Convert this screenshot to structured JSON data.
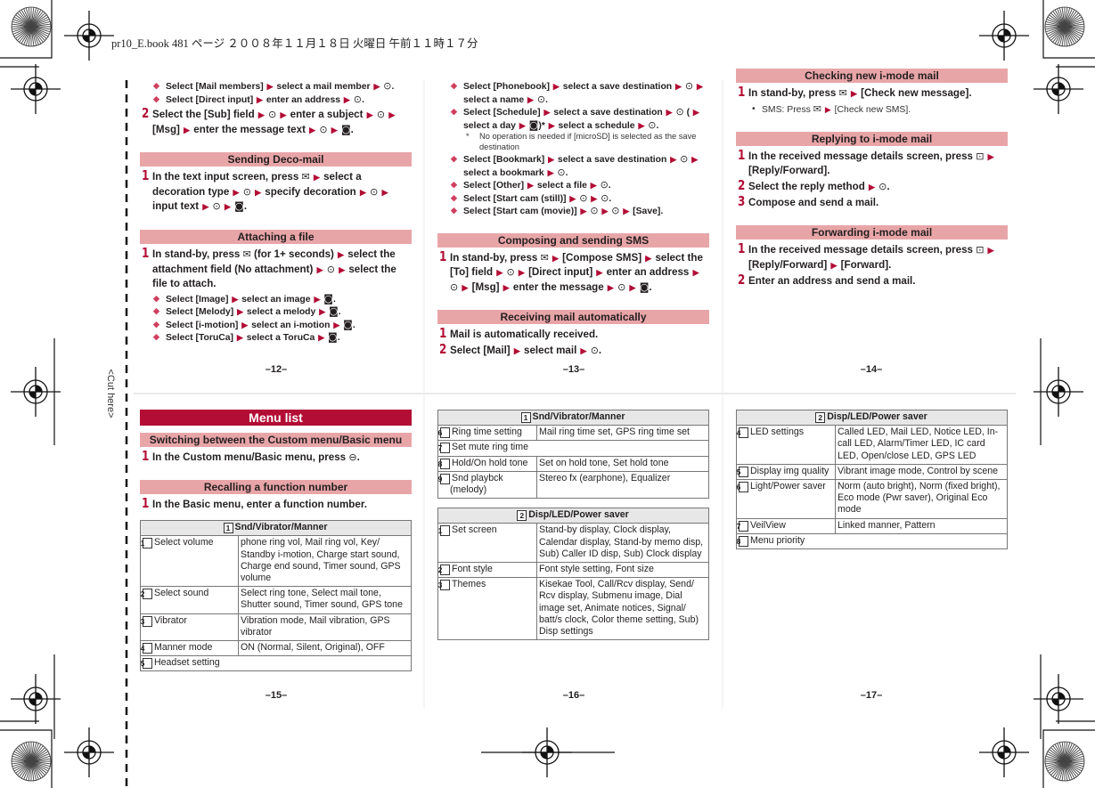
{
  "print_header": "pr10_E.book   481 ページ   ２００８年１１月１８日   火曜日   午前１１時１７分",
  "cut_label": "<Cut here>",
  "colors": {
    "accent": "#b30d35",
    "section_header_bg": "#e8a5a8",
    "menu_header_bg": "#b30d35",
    "table_header_bg": "#e7e7e7"
  },
  "icons": {
    "arrow": "arrow-right-icon",
    "center_key": "center-key-icon ⊙",
    "mail_key": "mail-key-icon ✉",
    "imode_key": "i-mode-key-icon ◙",
    "reply_key": "camera-key-icon ⊡",
    "menu_key": "menu-key-icon ⊖"
  },
  "page_numbers": [
    "–12–",
    "–13–",
    "–14–",
    "–15–",
    "–16–",
    "–17–"
  ],
  "columns": [
    {
      "blocks": [
        {
          "type": "bullet",
          "text": "Select [Mail members] ▶ select a mail member ▶ ⊙."
        },
        {
          "type": "bullet",
          "text": "Select [Direct input] ▶ enter an address ▶ ⊙."
        },
        {
          "type": "step",
          "num": "2",
          "text": "Select the [Sub] field ▶ ⊙ ▶ enter a subject ▶ ⊙ ▶ [Msg] ▶ enter the message text ▶ ⊙ ▶ ◙."
        },
        {
          "type": "header",
          "text": "Sending Deco-mail"
        },
        {
          "type": "step",
          "num": "1",
          "text": "In the text input screen, press ✉ ▶ select a decoration type ▶ ⊙ ▶ specify decoration ▶ ⊙ ▶ input text ▶ ⊙ ▶ ◙."
        },
        {
          "type": "header",
          "text": "Attaching a file"
        },
        {
          "type": "step",
          "num": "1",
          "text": "In stand-by, press ✉ (for 1+ seconds) ▶ select the attachment field (No attachment) ▶ ⊙ ▶ select the file to attach."
        },
        {
          "type": "bullet",
          "text": "Select [Image] ▶ select an image ▶ ◙."
        },
        {
          "type": "bullet",
          "text": "Select [Melody] ▶ select a melody ▶ ◙."
        },
        {
          "type": "bullet",
          "text": "Select [i-motion] ▶ select an i-motion ▶ ◙."
        },
        {
          "type": "bullet",
          "text": "Select [ToruCa] ▶ select a ToruCa ▶ ◙."
        }
      ]
    },
    {
      "blocks": [
        {
          "type": "bullet",
          "text": "Select [Phonebook] ▶ select a save destination ▶ ⊙ ▶ select a name ▶ ⊙."
        },
        {
          "type": "bullet",
          "text": "Select [Schedule] ▶ select a save destination ▶ ⊙ ( ▶ select a day ▶ ◙)* ▶ select a schedule ▶ ⊙."
        },
        {
          "type": "note",
          "mark": "*",
          "text": "No operation is needed if [microSD] is selected as the save destination"
        },
        {
          "type": "bullet",
          "text": "Select [Bookmark] ▶ select a save destination ▶ ⊙ ▶ select a bookmark ▶ ⊙."
        },
        {
          "type": "bullet",
          "text": "Select [Other] ▶ select a file ▶ ⊙."
        },
        {
          "type": "bullet",
          "text": "Select [Start cam (still)] ▶ ⊙ ▶ ⊙."
        },
        {
          "type": "bullet",
          "text": "Select [Start cam (movie)] ▶ ⊙ ▶ ⊙ ▶ [Save]."
        },
        {
          "type": "header",
          "text": "Composing and sending SMS"
        },
        {
          "type": "step",
          "num": "1",
          "text": "In stand-by, press ✉ ▶ [Compose SMS] ▶ select the [To] field ▶ ⊙ ▶ [Direct input] ▶ enter an address ▶ ⊙ ▶ [Msg] ▶ enter the message ▶ ⊙ ▶ ◙."
        },
        {
          "type": "header",
          "text": "Receiving mail automatically"
        },
        {
          "type": "step",
          "num": "1",
          "text": "Mail is automatically received."
        },
        {
          "type": "step",
          "num": "2",
          "text": "Select [Mail] ▶ select mail ▶ ⊙."
        }
      ]
    },
    {
      "blocks": [
        {
          "type": "header",
          "text": "Checking new i-mode mail"
        },
        {
          "type": "step",
          "num": "1",
          "text": "In stand-by, press ✉ ▶ [Check new message]."
        },
        {
          "type": "dot",
          "text": "SMS: Press ✉ ▶ [Check new SMS]."
        },
        {
          "type": "header",
          "text": "Replying to i-mode mail"
        },
        {
          "type": "step",
          "num": "1",
          "text": "In the received message details screen, press ⊡ ▶ [Reply/Forward]."
        },
        {
          "type": "step",
          "num": "2",
          "text": "Select the reply method ▶ ⊙."
        },
        {
          "type": "step",
          "num": "3",
          "text": "Compose and send a mail."
        },
        {
          "type": "header",
          "text": "Forwarding i-mode mail"
        },
        {
          "type": "step",
          "num": "1",
          "text": "In the received message details screen, press ⊡ ▶ [Reply/Forward] ▶ [Forward]."
        },
        {
          "type": "step",
          "num": "2",
          "text": "Enter an address and send a mail."
        }
      ]
    },
    {
      "blocks": [
        {
          "type": "mainheader",
          "text": "Menu list"
        },
        {
          "type": "header",
          "text": "Switching between the Custom menu/Basic menu",
          "first": true
        },
        {
          "type": "step",
          "num": "1",
          "text": "In the Custom menu/Basic menu, press ⊖."
        },
        {
          "type": "header",
          "text": "Recalling a function number"
        },
        {
          "type": "step",
          "num": "1",
          "text": "In the Basic menu, enter a function number."
        },
        {
          "type": "table",
          "num": "1",
          "title": "Snd/Vibrator/Manner",
          "rows": [
            {
              "num": "1",
              "label": "Select volume",
              "value": "phone ring vol, Mail ring vol, Key/ Standby i-motion, Charge start sound, Charge end sound, Timer sound, GPS volume"
            },
            {
              "num": "2",
              "label": "Select sound",
              "value": "Select ring tone, Select mail tone, Shutter sound, Timer sound, GPS tone"
            },
            {
              "num": "3",
              "label": "Vibrator",
              "value": "Vibration mode, Mail vibration, GPS vibrator"
            },
            {
              "num": "4",
              "label": "Manner mode",
              "value": "ON (Normal, Silent, Original), OFF"
            },
            {
              "num": "5",
              "label": "Headset setting"
            }
          ]
        }
      ]
    },
    {
      "blocks": [
        {
          "type": "table",
          "num": "1",
          "title": "Snd/Vibrator/Manner",
          "first": true,
          "rows": [
            {
              "num": "6",
              "label": "Ring time setting",
              "value": "Mail ring time set, GPS ring time set"
            },
            {
              "num": "7",
              "label": "Set mute ring time"
            },
            {
              "num": "8",
              "label": "Hold/On hold tone",
              "value": "Set on hold tone, Set hold tone"
            },
            {
              "num": "9",
              "label": "Snd playbck (melody)",
              "value": "Stereo fx (earphone), Equalizer"
            }
          ]
        },
        {
          "type": "table",
          "num": "2",
          "title": "Disp/LED/Power saver",
          "rows": [
            {
              "num": "1",
              "label": "Set screen",
              "value": "Stand-by display, Clock display, Calendar display, Stand-by memo disp, Sub) Caller ID disp, Sub) Clock display"
            },
            {
              "num": "2",
              "label": "Font style",
              "value": "Font style setting, Font size"
            },
            {
              "num": "3",
              "label": "Themes",
              "value": "Kisekae Tool, Call/Rcv display, Send/ Rcv display, Submenu image, Dial image set, Animate notices, Signal/ batt/s clock, Color theme setting, Sub) Disp settings"
            }
          ]
        }
      ]
    },
    {
      "blocks": [
        {
          "type": "table",
          "num": "2",
          "title": "Disp/LED/Power saver",
          "first": true,
          "rows": [
            {
              "num": "4",
              "label": "LED settings",
              "value": "Called LED, Mail LED, Notice LED, In-call LED, Alarm/Timer LED, IC card LED, Open/close LED, GPS LED"
            },
            {
              "num": "5",
              "label": "Display img quality",
              "value": "Vibrant image mode, Control by scene"
            },
            {
              "num": "6",
              "label": "Light/Power saver",
              "value": "Norm (auto bright), Norm (fixed bright), Eco mode (Pwr saver), Original Eco mode"
            },
            {
              "num": "7",
              "label": "VeilView",
              "value": "Linked manner, Pattern"
            },
            {
              "num": "8",
              "label": "Menu priority"
            }
          ]
        }
      ]
    }
  ]
}
